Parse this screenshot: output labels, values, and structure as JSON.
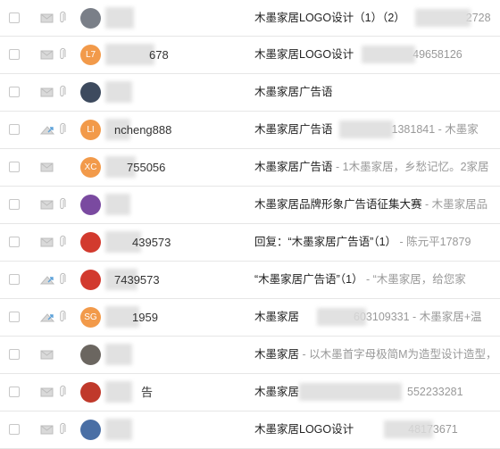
{
  "mail_list": {
    "rows": [
      {
        "avatar": {
          "type": "photo",
          "color": "#7a7f88",
          "text": ""
        },
        "sender": "",
        "subject": "木墨家居LOGO设计（1）（2）",
        "summary": "2728",
        "read": true,
        "attachment": true
      },
      {
        "avatar": {
          "type": "initials",
          "color": "#f29a4a",
          "text": "L7"
        },
        "sender": "678",
        "subject": "木墨家居LOGO设计",
        "summary": "49658126",
        "read": true,
        "attachment": true
      },
      {
        "avatar": {
          "type": "photo",
          "color": "#3d4a5e",
          "text": ""
        },
        "sender": "",
        "subject": "木墨家居广告语",
        "summary": "",
        "read": true,
        "attachment": true
      },
      {
        "avatar": {
          "type": "initials",
          "color": "#f29a4a",
          "text": "LI"
        },
        "sender": "ncheng888",
        "subject": "木墨家居广告语",
        "summary": "1381841 - 木墨家",
        "read": false,
        "attachment": true
      },
      {
        "avatar": {
          "type": "initials",
          "color": "#f29a4a",
          "text": "XC"
        },
        "sender": "755056",
        "subject": "木墨家居广告语",
        "summary": " - 1木墨家居，乡愁记忆。2家居",
        "read": true,
        "attachment": false
      },
      {
        "avatar": {
          "type": "photo",
          "color": "#7a4aa0",
          "text": ""
        },
        "sender": "",
        "subject": "木墨家居品牌形象广告语征集大赛",
        "summary": " - 木墨家居品",
        "read": true,
        "attachment": true
      },
      {
        "avatar": {
          "type": "photo",
          "color": "#d23a2e",
          "text": ""
        },
        "sender": "439573",
        "subject": "回复：“木墨家居广告语”（1）",
        "summary": " - 陈元平17879",
        "read": true,
        "attachment": true
      },
      {
        "avatar": {
          "type": "photo",
          "color": "#d23a2e",
          "text": ""
        },
        "sender": "7439573",
        "subject": "“木墨家居广告语”（1）",
        "summary": " - “木墨家居，给您家",
        "read": false,
        "attachment": true
      },
      {
        "avatar": {
          "type": "initials",
          "color": "#f29a4a",
          "text": "SG"
        },
        "sender": "1959",
        "subject": "木墨家居",
        "summary": "603109331 - 木墨家居+温",
        "read": false,
        "attachment": true
      },
      {
        "avatar": {
          "type": "photo",
          "color": "#6b6660",
          "text": ""
        },
        "sender": "",
        "subject": "木墨家居",
        "summary": " - 以木墨首字母极简M为造型设计造型，",
        "read": true,
        "attachment": false
      },
      {
        "avatar": {
          "type": "photo",
          "color": "#c0392b",
          "text": ""
        },
        "sender": "告",
        "subject": "木墨家居",
        "summary": "552233281",
        "read": true,
        "attachment": true
      },
      {
        "avatar": {
          "type": "photo",
          "color": "#4a6fa5",
          "text": ""
        },
        "sender": "",
        "subject": "木墨家居LOGO设计",
        "summary": "48173671",
        "read": true,
        "attachment": true
      }
    ]
  }
}
